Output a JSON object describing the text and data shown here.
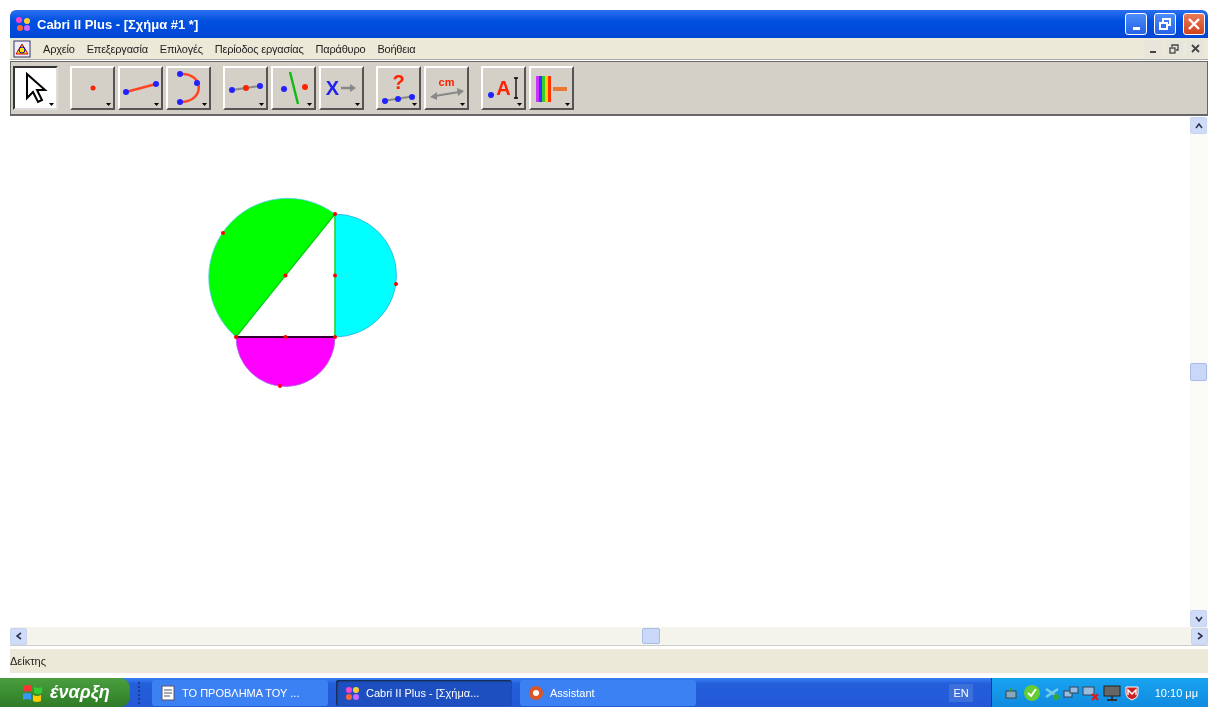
{
  "window": {
    "title": "Cabri II Plus - [Σχήμα #1 *]"
  },
  "menu": [
    "Αρχείο",
    "Επεξεργασία",
    "Επιλογές",
    "Περίοδος εργασίας",
    "Παράθυρο",
    "Βοήθεια"
  ],
  "toolbar": [
    [
      {
        "kind": "pointer",
        "selected": true
      }
    ],
    [
      {
        "kind": "point",
        "selected": false
      },
      {
        "kind": "segment",
        "selected": false
      },
      {
        "kind": "arc",
        "selected": false
      }
    ],
    [
      {
        "kind": "midpoint",
        "selected": false
      },
      {
        "kind": "perpendicular",
        "selected": false
      },
      {
        "kind": "transform",
        "glyph": "X",
        "selected": false
      }
    ],
    [
      {
        "kind": "query",
        "glyph": "?",
        "selected": false
      },
      {
        "kind": "measure",
        "glyph": "cm",
        "selected": false
      }
    ],
    [
      {
        "kind": "label",
        "glyph": "A",
        "selected": false
      },
      {
        "kind": "palette",
        "selected": false
      }
    ]
  ],
  "status_bar": "Δείκτης",
  "taskbar": {
    "start": "έναρξη",
    "tasks": [
      {
        "label": "ΤΟ ΠΡΟΒΛΗΜΑ ΤΟΥ ...",
        "kind": "document",
        "selected": false
      },
      {
        "label": "Cabri II Plus - [Σχήμα...",
        "kind": "cabri",
        "selected": true
      },
      {
        "label": "Assistant",
        "kind": "assistant",
        "selected": false
      }
    ],
    "language": "EN",
    "clock": "10:10 μμ"
  }
}
